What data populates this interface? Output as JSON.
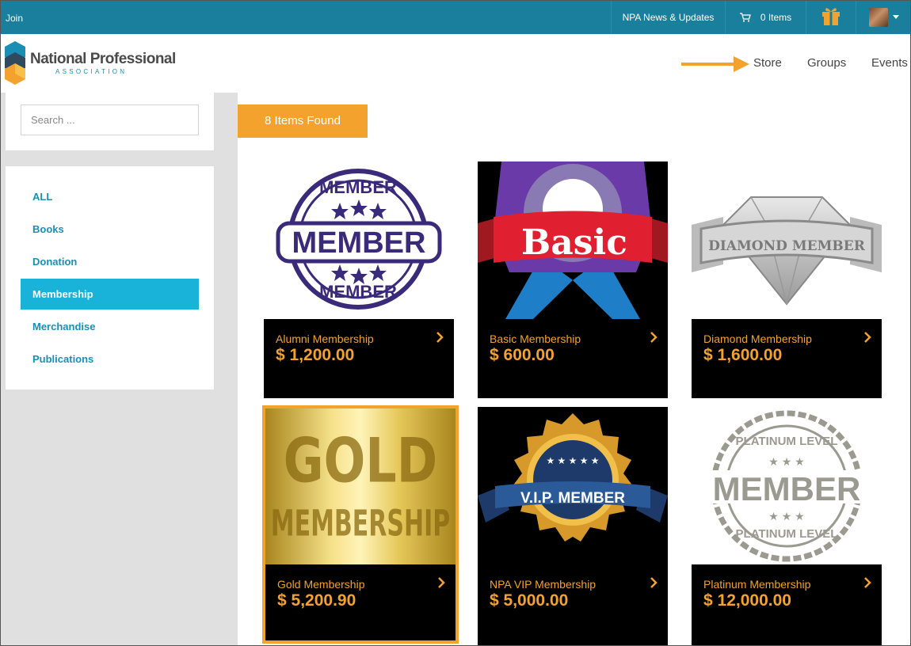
{
  "topbar": {
    "join": "Join",
    "news": "NPA News & Updates",
    "cart": "0 Items"
  },
  "header": {
    "logo_name": "National Professional",
    "logo_sub": "ASSOCIATION",
    "nav": [
      "Store",
      "Groups",
      "Events"
    ]
  },
  "colors": {
    "topbar": "#1a7f9c",
    "accent": "#f3a22d",
    "active_category": "#19b3da",
    "link": "#1a8fb5"
  },
  "search": {
    "placeholder": "Search ...",
    "value": ""
  },
  "categories": [
    {
      "label": "ALL",
      "active": false
    },
    {
      "label": "Books",
      "active": false
    },
    {
      "label": "Donation",
      "active": false
    },
    {
      "label": "Membership",
      "active": true
    },
    {
      "label": "Merchandise",
      "active": false
    },
    {
      "label": "Publications",
      "active": false
    }
  ],
  "results": {
    "count_label": "8 Items Found"
  },
  "products": [
    {
      "name": "Alumni Membership",
      "price": "$ 1,200.00",
      "badge_top": "MEMBER",
      "badge_main": "MEMBER",
      "badge_bottom": "MEMBER"
    },
    {
      "name": "Basic Membership",
      "price": "$ 600.00",
      "badge_main": "Basic"
    },
    {
      "name": "Diamond Membership",
      "price": "$ 1,600.00",
      "badge_main": "DIAMOND MEMBER"
    },
    {
      "name": "Gold Membership",
      "price": "$ 5,200.90",
      "badge_top": "GOLD",
      "badge_main": "MEMBERSHIP"
    },
    {
      "name": "NPA VIP Membership",
      "price": "$ 5,000.00",
      "badge_main": "V.I.P. MEMBER"
    },
    {
      "name": "Platinum Membership",
      "price": "$ 12,000.00",
      "badge_top": "PLATINUM LEVEL",
      "badge_main": "MEMBER",
      "badge_bottom": "PLATINUM LEVEL"
    }
  ]
}
